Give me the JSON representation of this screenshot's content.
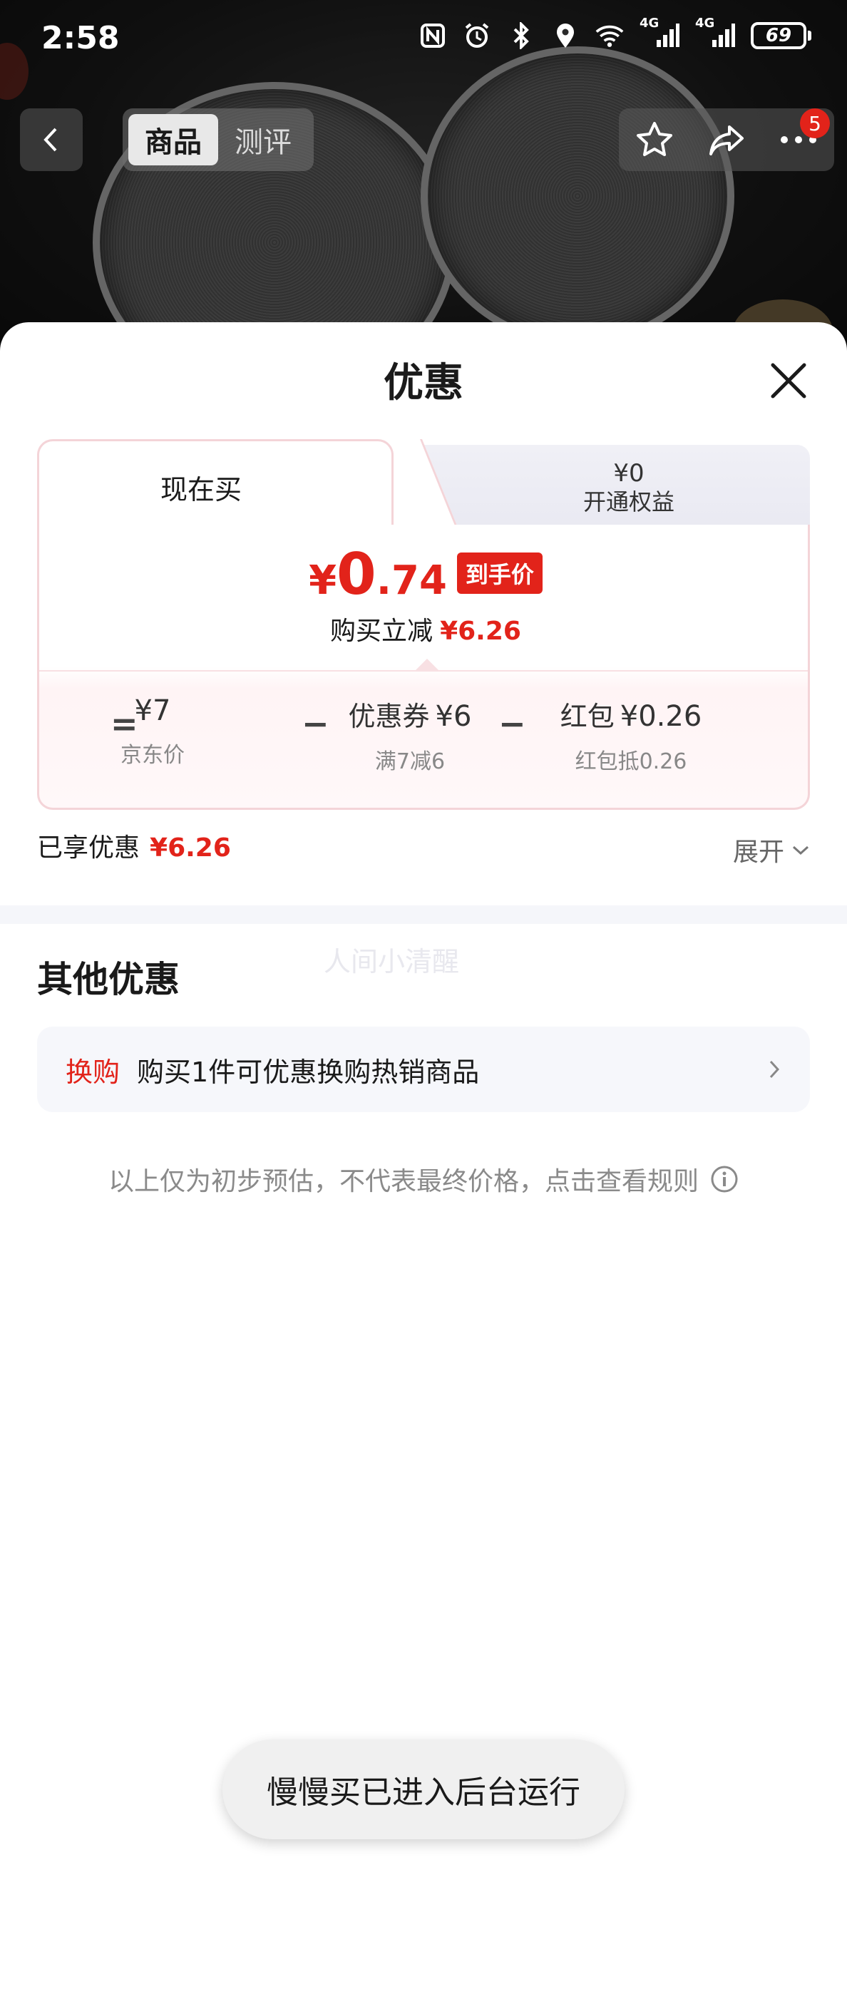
{
  "status_bar": {
    "time": "2:58",
    "battery": "69",
    "net1": "4G",
    "net2": "4G"
  },
  "nav": {
    "tabs": [
      {
        "label": "商品",
        "active": true
      },
      {
        "label": "测评",
        "active": false
      }
    ],
    "badge_count": "5"
  },
  "sheet": {
    "title": "优惠",
    "card": {
      "tab_now": "现在买",
      "tab_open_amount": "¥0",
      "tab_open_label": "开通权益",
      "final_price_symbol": "¥",
      "final_price_int": "0",
      "final_price_dec": ".74",
      "final_tag": "到手价",
      "reduce_label": "购买立减",
      "reduce_amount": "¥6.26",
      "breakdown": {
        "eq": "=",
        "op1": "−",
        "op2": "−",
        "jd_price": "¥7",
        "jd_label": "京东价",
        "coupon_prefix": "优惠券",
        "coupon_amount": "¥6",
        "coupon_sub": "满7减6",
        "redpack_prefix": "红包",
        "redpack_amount": "¥0.26",
        "redpack_sub": "红包抵0.26"
      }
    },
    "enjoyed_label": "已享优惠",
    "enjoyed_amount": "¥6.26",
    "expand_label": "展开",
    "other_title": "其他优惠",
    "watermark": "人间小清醒",
    "swap": {
      "tag": "换购",
      "text": "购买1件可优惠换购热销商品"
    },
    "rule_note": "以上仅为初步预估，不代表最终价格，点击查看规则"
  },
  "toast": "慢慢买已进入后台运行",
  "colors": {
    "accent_red": "#e2231a",
    "card_border": "#f4d4d8",
    "row_bg": "#f6f7fb"
  }
}
